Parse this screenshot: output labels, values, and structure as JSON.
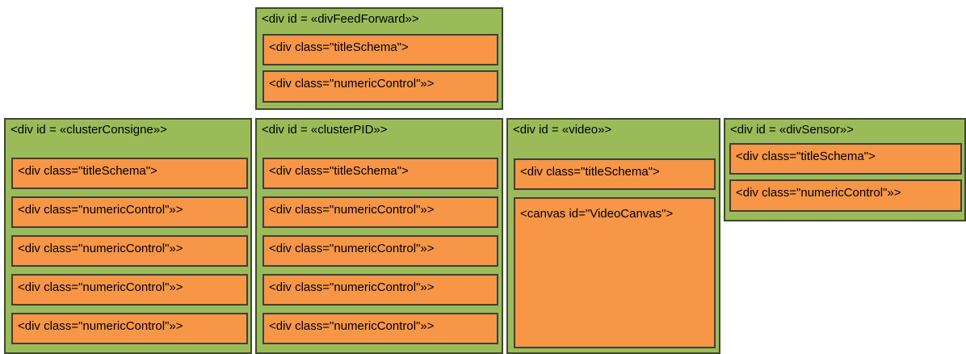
{
  "diagram": {
    "feedforward": {
      "title": "<div  id = «divFeedForward»>",
      "items": [
        "<div class=\"titleSchema\">",
        "<div  class=\"numericControl\"»>"
      ]
    },
    "consigne": {
      "title": "<div  id = «clusterConsigne»>",
      "items": [
        "<div class=\"titleSchema\">",
        "<div  class=\"numericControl\"»>",
        "<div  class=\"numericControl\"»>",
        "<div  class=\"numericControl\"»>",
        "<div  class=\"numericControl\"»>"
      ]
    },
    "pid": {
      "title": "<div id = «clusterPID»>",
      "items": [
        "<div class=\"titleSchema\">",
        "<div  class=\"numericControl\"»>",
        "<div  class=\"numericControl\"»>",
        "<div  class=\"numericControl\"»>",
        "<div  class=\"numericControl\"»>"
      ]
    },
    "video": {
      "title": "<div id = «video»>",
      "items": [
        "<div class=\"titleSchema\">",
        "<canvas id=\"VideoCanvas\">"
      ]
    },
    "sensor": {
      "title": "<div  id = «divSensor»>",
      "items": [
        "<div class=\"titleSchema\">",
        "<div  class=\"numericControl\"»>"
      ]
    }
  }
}
